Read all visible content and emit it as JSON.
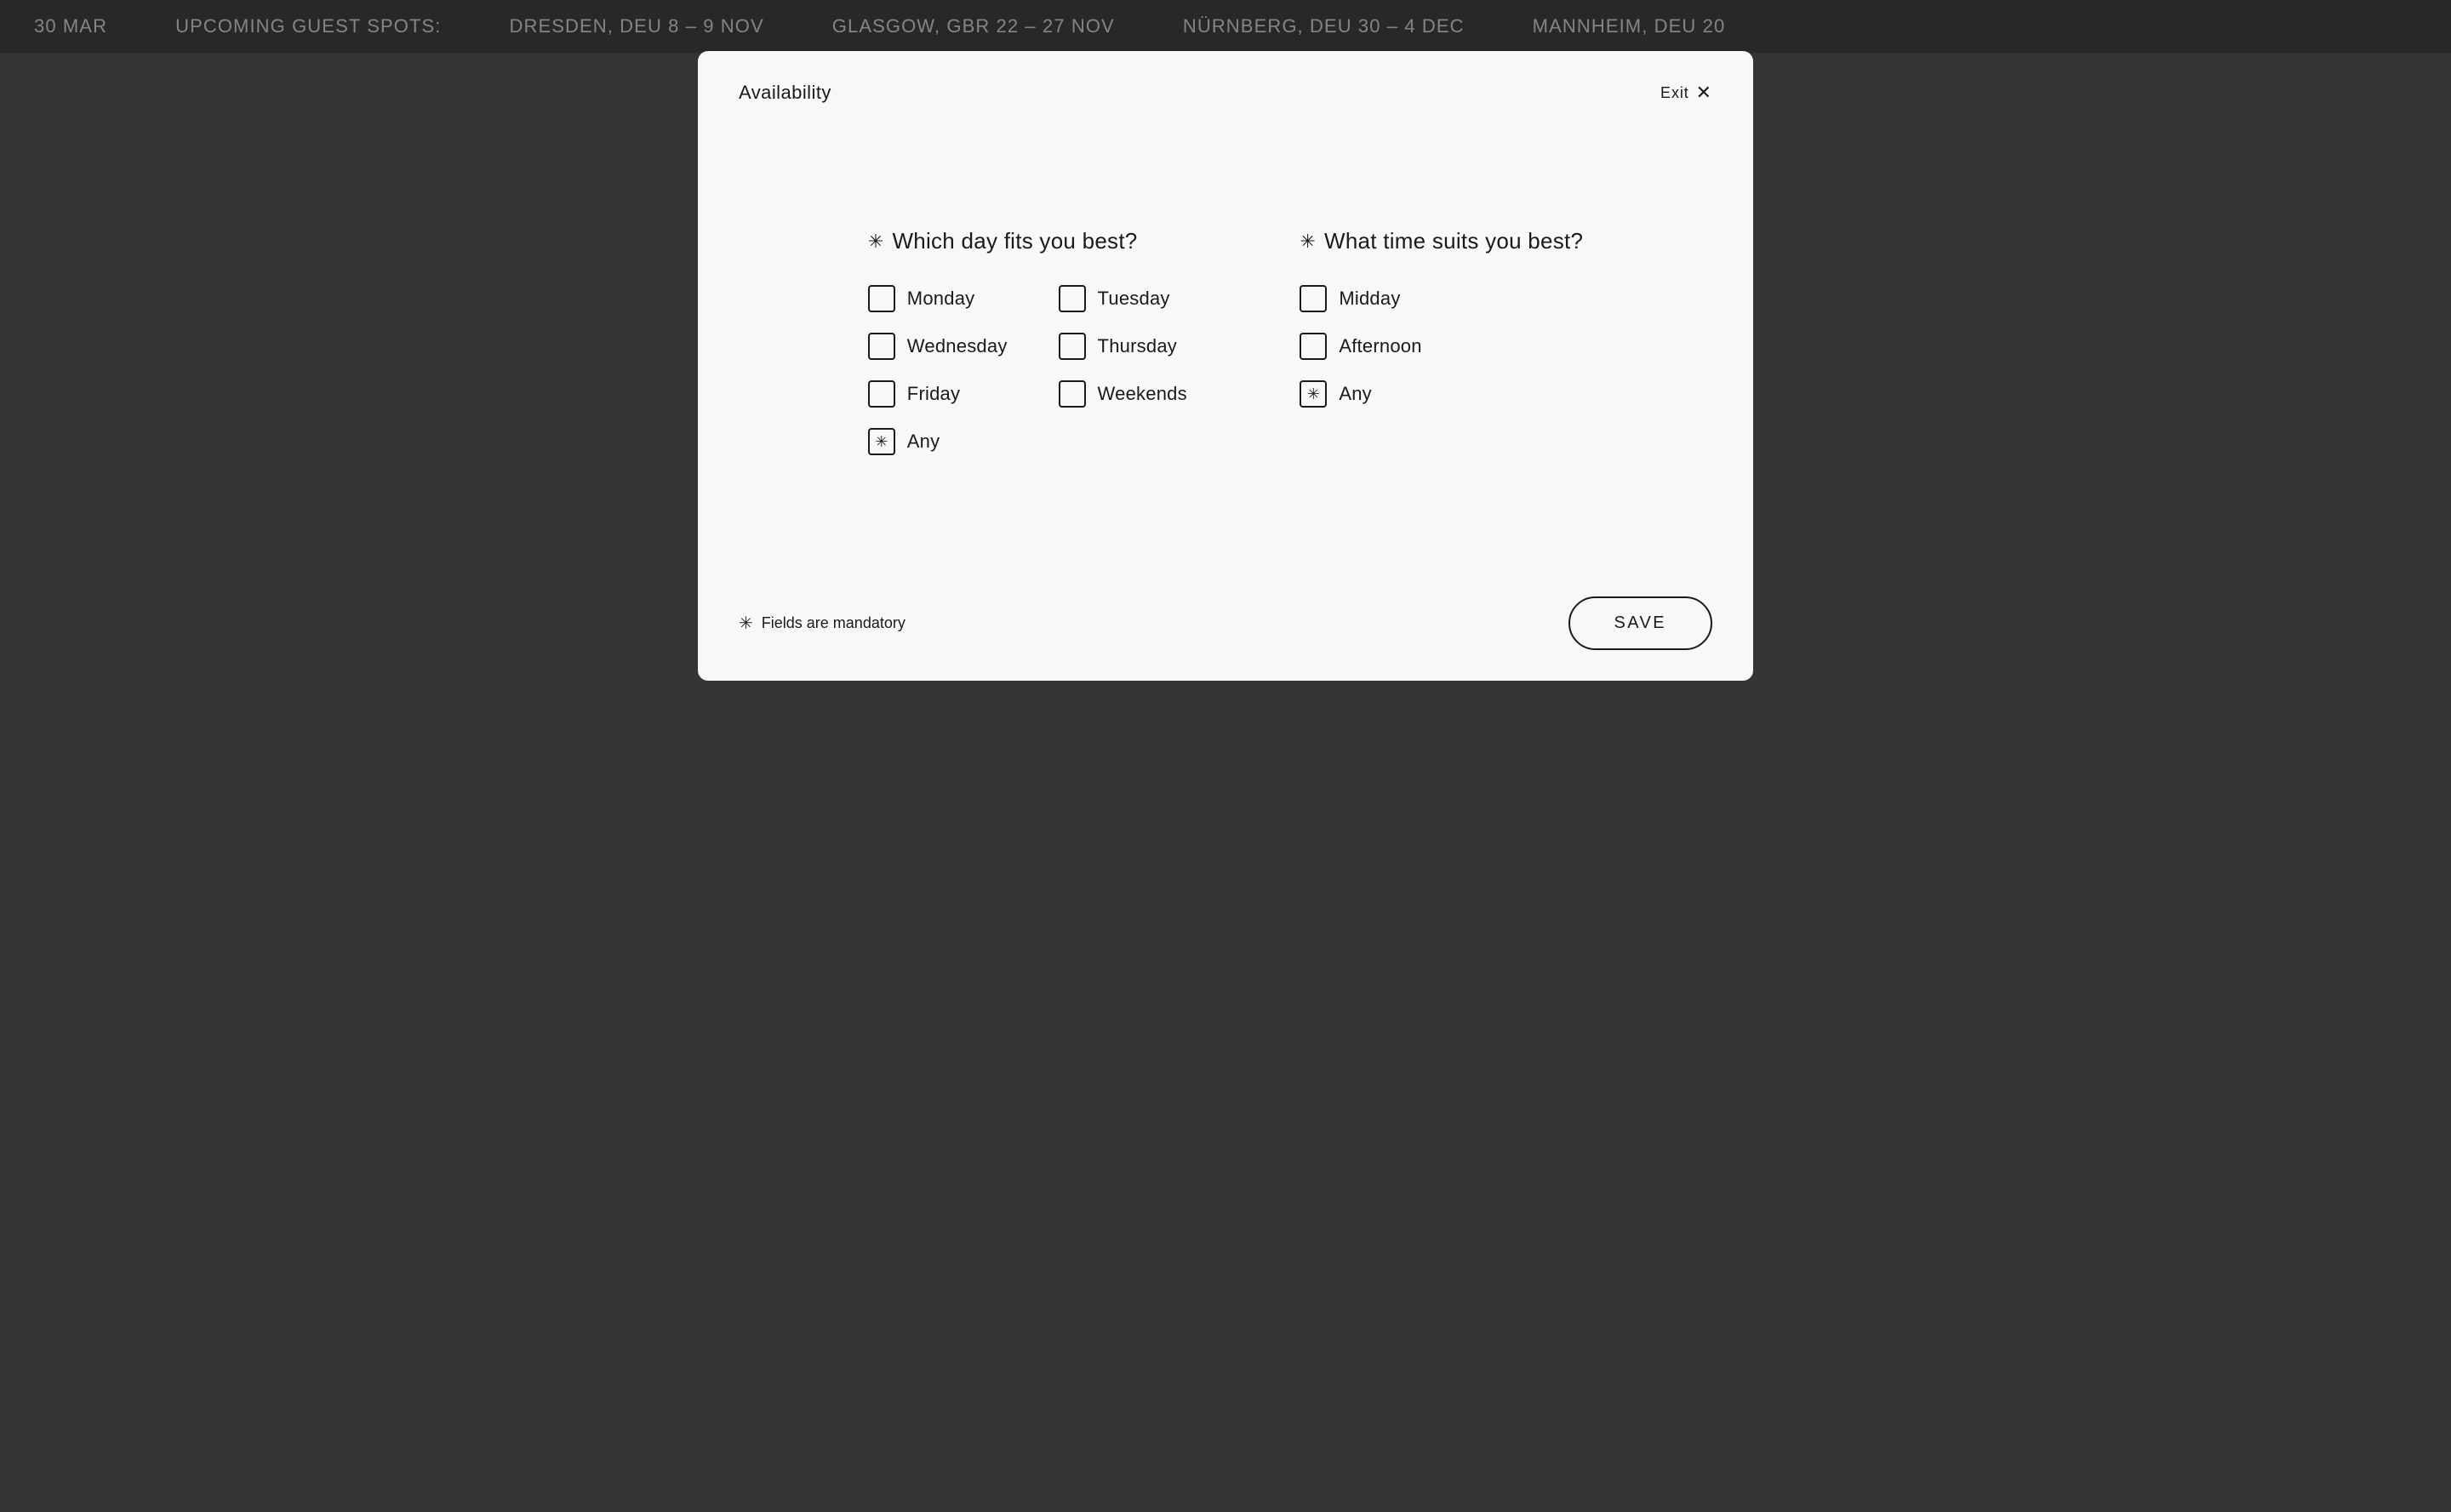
{
  "ticker": {
    "items": [
      "30 MAR",
      "UPCOMING GUEST SPOTS:",
      "DRESDEN, DEU 8 – 9 NOV",
      "GLASGOW, GBR 22 – 27 NOV",
      "NÜRNBERG, DEU 30 – 4 DEC",
      "MANNHEIM, DEU 20"
    ]
  },
  "modal": {
    "title": "Availability",
    "exit_label": "Exit",
    "days_section": {
      "title": "Which day fits you best?",
      "items": [
        {
          "id": "monday",
          "label": "Monday",
          "checked": false
        },
        {
          "id": "tuesday",
          "label": "Tuesday",
          "checked": false
        },
        {
          "id": "wednesday",
          "label": "Wednesday",
          "checked": false
        },
        {
          "id": "thursday",
          "label": "Thursday",
          "checked": false
        },
        {
          "id": "friday",
          "label": "Friday",
          "checked": false
        },
        {
          "id": "weekends",
          "label": "Weekends",
          "checked": false
        },
        {
          "id": "any-day",
          "label": "Any",
          "checked": true
        }
      ]
    },
    "time_section": {
      "title": "What time suits you best?",
      "items": [
        {
          "id": "midday",
          "label": "Midday",
          "checked": false
        },
        {
          "id": "afternoon",
          "label": "Afternoon",
          "checked": false
        },
        {
          "id": "any-time",
          "label": "Any",
          "checked": true
        }
      ]
    },
    "footer": {
      "mandatory_text": "Fields are mandatory",
      "save_label": "SAVE"
    }
  }
}
